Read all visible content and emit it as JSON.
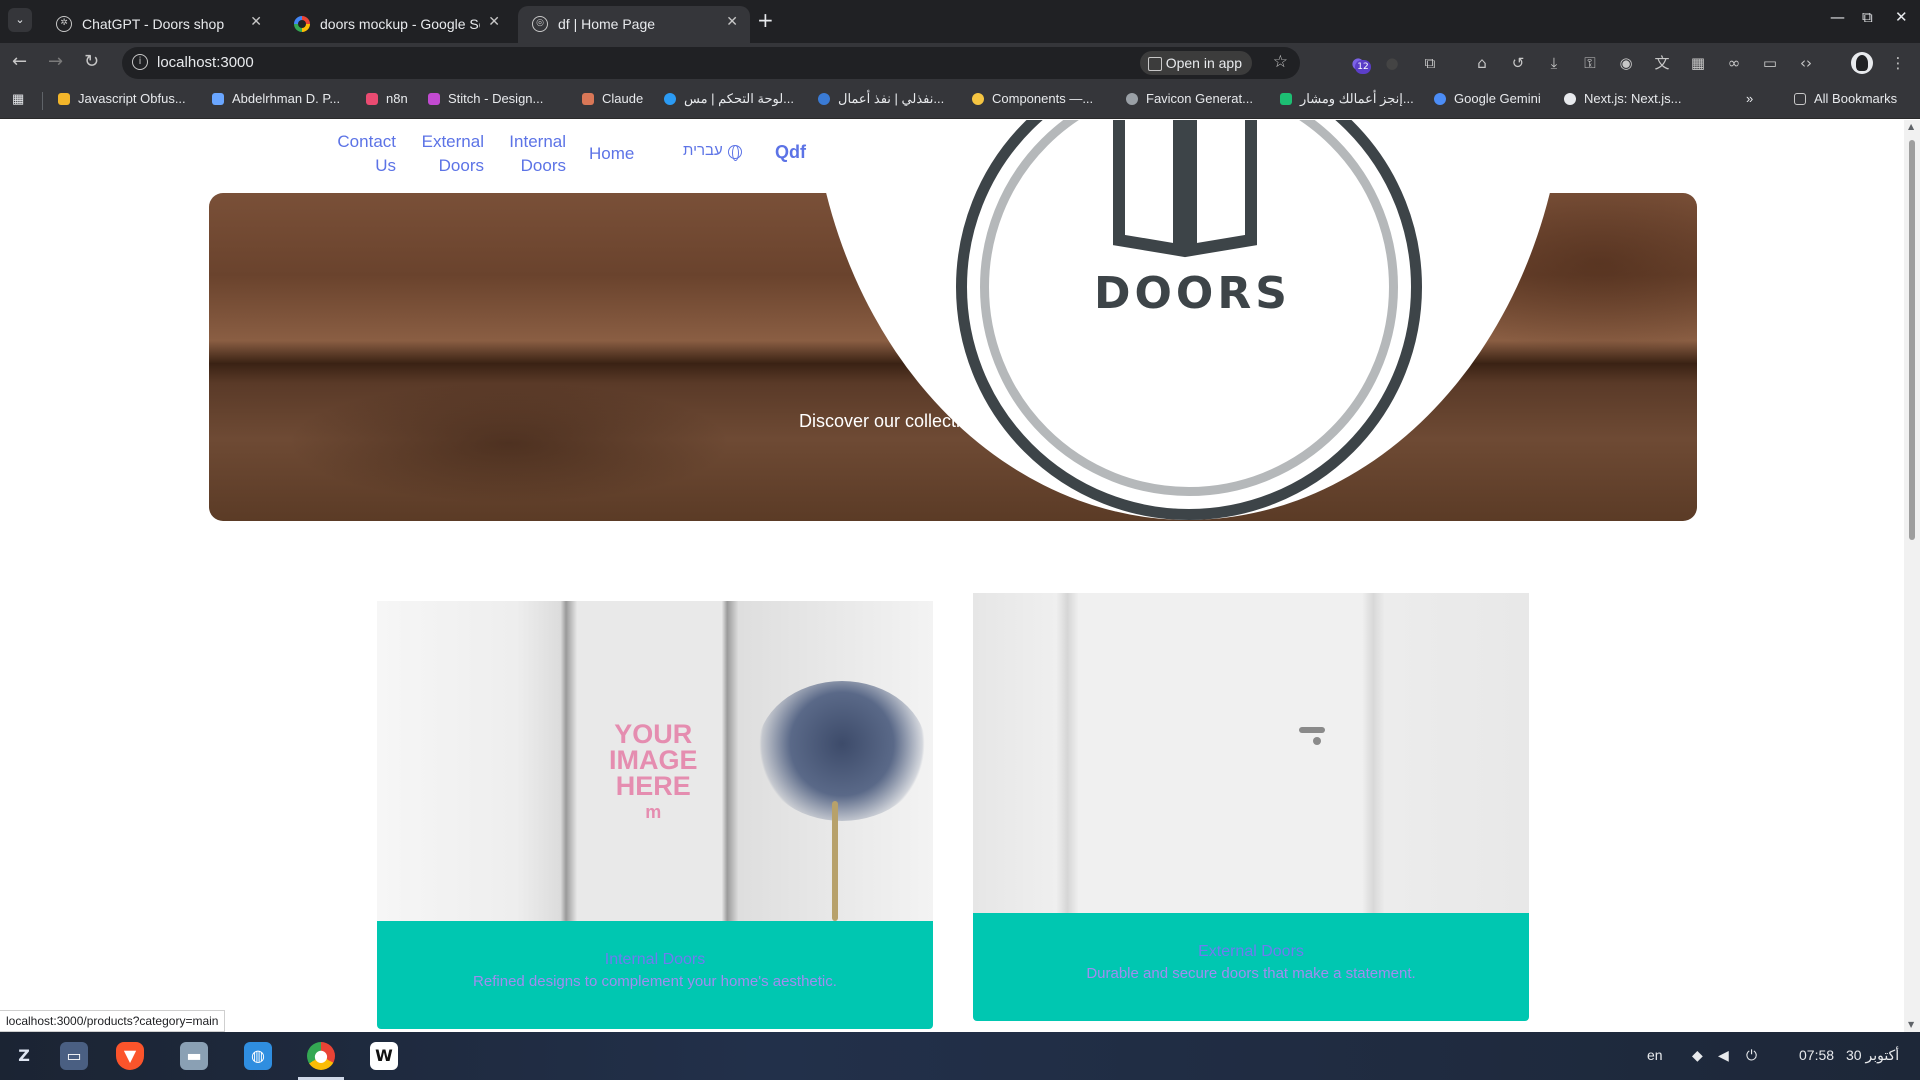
{
  "browser": {
    "tabs": [
      {
        "title": "ChatGPT - Doors shop",
        "active": false
      },
      {
        "title": "doors mockup - Google Se",
        "active": false
      },
      {
        "title": "df | Home Page",
        "active": true
      }
    ],
    "new_tab": "+",
    "url": "localhost:3000",
    "open_in_app": "Open in app",
    "extension_badge": "12",
    "bookmarks": [
      "Javascript Obfus...",
      "Abdelrhman D. P...",
      "n8n",
      "Stitch - Design...",
      "Claude",
      "لوحة التحكم | مس...",
      "نفذلي | نفذ أعمال...",
      "Components —...",
      "Favicon Generat...",
      "إنجز أعمالك ومشار...",
      "Google Gemini",
      "Next.js: Next.js..."
    ],
    "bookmarks_overflow": "»",
    "all_bookmarks": "All Bookmarks",
    "status_url": "localhost:3000/products?category=main"
  },
  "site": {
    "nav": {
      "contact_line1": "Contact",
      "contact_line2": "Us",
      "external_line1": "External",
      "external_line2": "Doors",
      "internal_line1": "Internal",
      "internal_line2": "Doors",
      "home": "Home",
      "language": "עברית",
      "brand": "Qdf"
    },
    "logo_text": "DOORS",
    "hero_text": "Discover our collection of premi",
    "cards": [
      {
        "placeholder_line1": "YOUR",
        "placeholder_line2": "IMAGE",
        "placeholder_line3": "HERE",
        "placeholder_mark": "m",
        "title": "Internal Doors",
        "description": "Refined designs to complement your home's aesthetic."
      },
      {
        "title": "External Doors",
        "description": "Durable and secure doors that make a statement."
      }
    ]
  },
  "taskbar": {
    "language": "en",
    "time": "07:58",
    "date": "30 أكتوبر"
  }
}
